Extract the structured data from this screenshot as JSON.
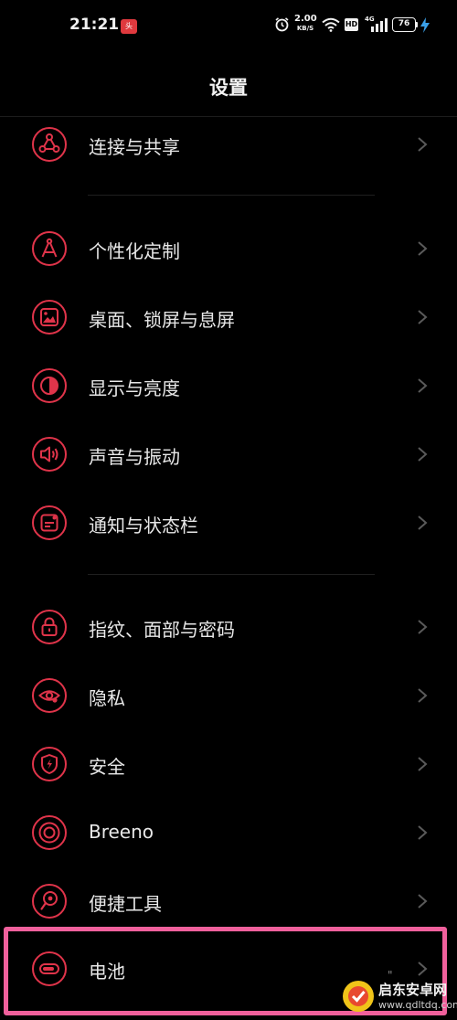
{
  "status_bar": {
    "time": "21:21",
    "notification_icon": "toutiao-app-icon",
    "alarm_icon": "alarm-clock-icon",
    "net_speed_value": "2.00",
    "net_speed_unit": "KB/S",
    "wifi_icon": "wifi-icon",
    "hd_label": "HD",
    "network_type": "4G",
    "signal_icon": "signal-bars-icon",
    "battery_level": "76",
    "charging_icon": "lightning-bolt-icon"
  },
  "header": {
    "title": "设置"
  },
  "settings_items": [
    {
      "label": "连接与共享",
      "icon": "share-nodes-icon"
    },
    {
      "label": "个性化定制",
      "icon": "compass-pen-icon"
    },
    {
      "label": "桌面、锁屏与息屏",
      "icon": "wallpaper-image-icon"
    },
    {
      "label": "显示与亮度",
      "icon": "brightness-contrast-icon"
    },
    {
      "label": "声音与振动",
      "icon": "speaker-volume-icon"
    },
    {
      "label": "通知与状态栏",
      "icon": "notification-box-icon"
    },
    {
      "label": "指纹、面部与密码",
      "icon": "lock-icon"
    },
    {
      "label": "隐私",
      "icon": "eye-privacy-icon"
    },
    {
      "label": "安全",
      "icon": "shield-bolt-icon"
    },
    {
      "label": "Breeno",
      "icon": "breeno-rings-icon"
    },
    {
      "label": "便捷工具",
      "icon": "tools-icon"
    },
    {
      "label": "电池",
      "icon": "battery-icon",
      "trailing": "\""
    }
  ],
  "watermark": {
    "name": "启东安卓网",
    "url": "www.qdltdq.com"
  },
  "colors": {
    "accent": "#e0344a",
    "highlight_border": "#f0609c",
    "background": "#000000"
  }
}
